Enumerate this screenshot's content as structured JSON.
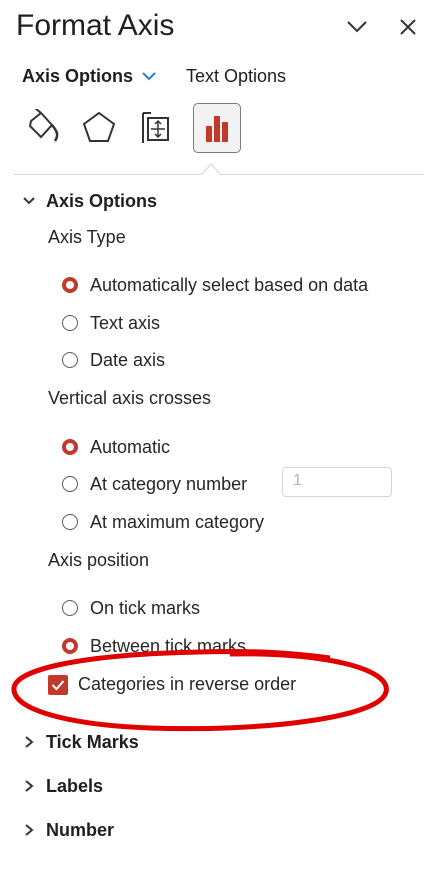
{
  "panel": {
    "title": "Format Axis"
  },
  "tabs": {
    "axis_options": "Axis Options",
    "text_options": "Text Options"
  },
  "icon_tabs": [
    "fill-line-icon",
    "effects-icon",
    "size-properties-icon",
    "axis-options-icon"
  ],
  "sections": {
    "axis_options": "Axis Options",
    "tick_marks": "Tick Marks",
    "labels": "Labels",
    "number": "Number"
  },
  "axis_type": {
    "label": "Axis Type",
    "options": [
      "Automatically select based on data",
      "Text axis",
      "Date axis"
    ],
    "selected": 0
  },
  "vertical_crosses": {
    "label": "Vertical axis crosses",
    "options": [
      "Automatic",
      "At category number",
      "At maximum category"
    ],
    "category_number_value": "1",
    "selected": 0
  },
  "axis_position": {
    "label": "Axis position",
    "options": [
      "On tick marks",
      "Between tick marks"
    ],
    "selected": 1
  },
  "reverse_order": {
    "label": "Categories in reverse order",
    "checked": true
  },
  "colors": {
    "accent": "#c0392b",
    "annotation": "#e00000"
  }
}
